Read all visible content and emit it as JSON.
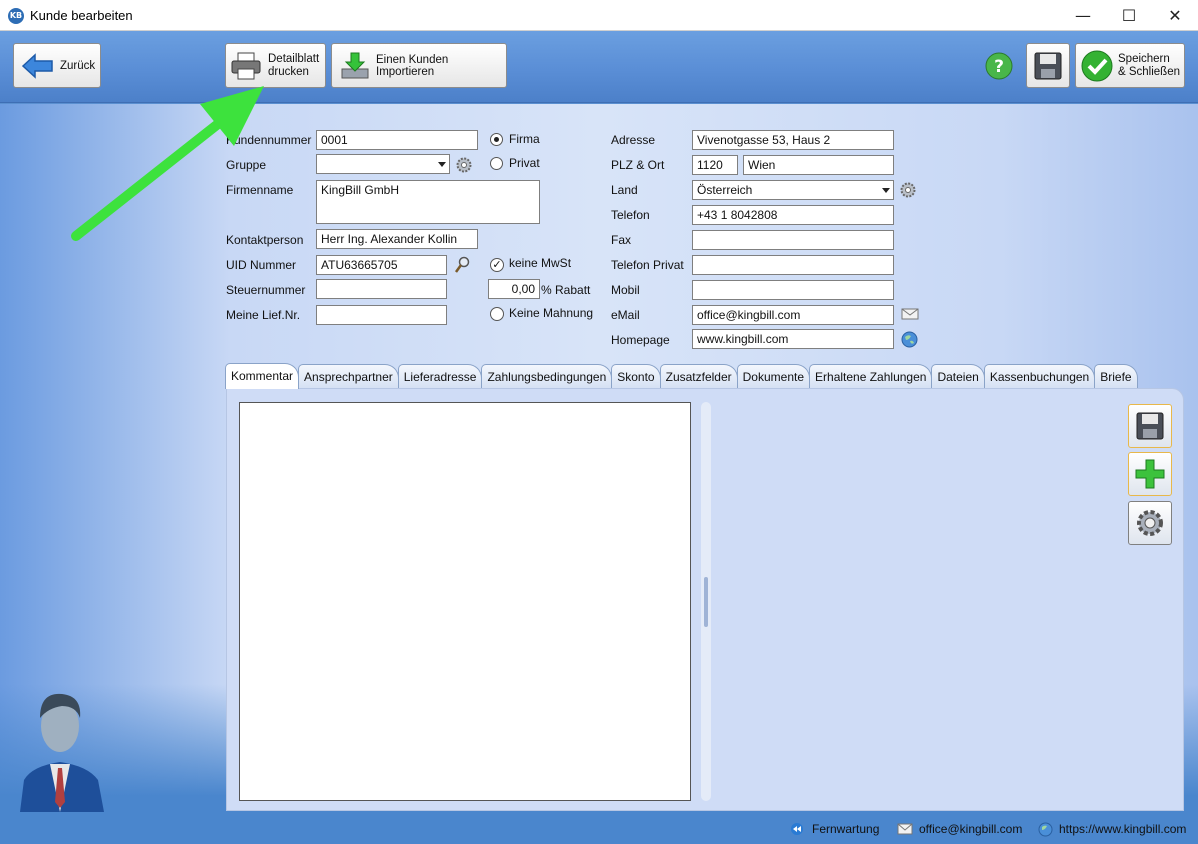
{
  "window": {
    "logo": "KB",
    "title": "Kunde bearbeiten",
    "minimize": "—",
    "maximize": "☐",
    "close": "✕"
  },
  "toolbar": {
    "back_label": "Zurück",
    "print_label_line1": "Detailblatt",
    "print_label_line2": "drucken",
    "import_label": "Einen Kunden Importieren",
    "help_icon": "help-icon",
    "save_close_line1": "Speichern",
    "save_close_line2": "& Schließen"
  },
  "form": {
    "kundennummer_label": "Kundennummer",
    "kundennummer_value": "0001",
    "firma_label": "Firma",
    "privat_label": "Privat",
    "gruppe_label": "Gruppe",
    "gruppe_value": "",
    "firmenname_label": "Firmenname",
    "firmenname_value": "KingBill GmbH",
    "kontaktperson_label": "Kontaktperson",
    "kontaktperson_value": "Herr Ing. Alexander Kollin",
    "uid_label": "UID Nummer",
    "uid_value": "ATU63665705",
    "keine_mwst_label": "keine MwSt",
    "steuernummer_label": "Steuernummer",
    "steuernummer_value": "",
    "rabatt_value": "0,00",
    "rabatt_label": "% Rabatt",
    "lief_label": "Meine Lief.Nr.",
    "lief_value": "",
    "keine_mahnung_label": "Keine Mahnung",
    "adresse_label": "Adresse",
    "adresse_value": "Vivenotgasse 53, Haus 2",
    "plz_label": "PLZ & Ort",
    "plz_value": "1120",
    "ort_value": "Wien",
    "land_label": "Land",
    "land_value": "Österreich",
    "telefon_label": "Telefon",
    "telefon_value": "+43 1 8042808",
    "fax_label": "Fax",
    "fax_value": "",
    "telefon_privat_label": "Telefon Privat",
    "telefon_privat_value": "",
    "mobil_label": "Mobil",
    "mobil_value": "",
    "email_label": "eMail",
    "email_value": "office@kingbill.com",
    "homepage_label": "Homepage",
    "homepage_value": "www.kingbill.com"
  },
  "tabs": [
    "Kommentar",
    "Ansprechpartner",
    "Lieferadresse",
    "Zahlungsbedingungen",
    "Skonto",
    "Zusatzfelder",
    "Dokumente",
    "Erhaltene Zahlungen",
    "Dateien",
    "Kassenbuchungen",
    "Briefe"
  ],
  "statusbar": {
    "fernwartung": "Fernwartung",
    "email": "office@kingbill.com",
    "website": "https://www.kingbill.com"
  },
  "colors": {
    "toolbar": "#5a8ed6",
    "arrow": "#3de23d",
    "accent_green": "#34b233"
  }
}
